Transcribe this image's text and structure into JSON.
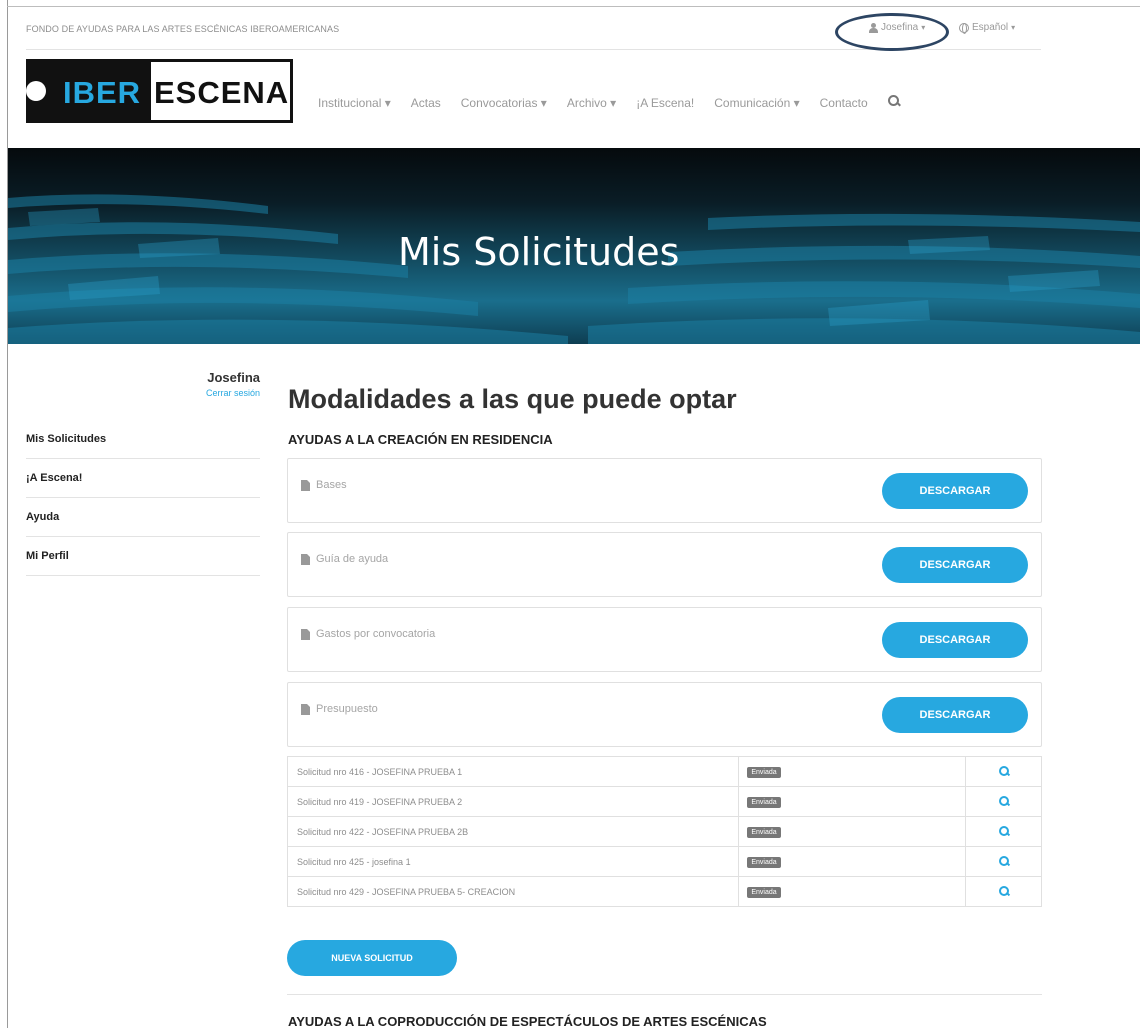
{
  "header": {
    "tagline": "FONDO DE AYUDAS PARA LAS ARTES ESCÉNICAS IBEROAMERICANAS",
    "user_menu": "Josefina",
    "language_menu": "Español",
    "caret": "▾"
  },
  "logo": {
    "part1": "IBER",
    "part2": "ESCENA"
  },
  "nav": {
    "items": [
      {
        "label": "Institucional",
        "caret": " ▾"
      },
      {
        "label": "Actas",
        "caret": ""
      },
      {
        "label": "Convocatorias",
        "caret": " ▾"
      },
      {
        "label": "Archivo",
        "caret": " ▾"
      },
      {
        "label": "¡A Escena!",
        "caret": ""
      },
      {
        "label": "Comunicación",
        "caret": " ▾"
      },
      {
        "label": "Contacto",
        "caret": ""
      }
    ]
  },
  "hero": {
    "title": "Mis Solicitudes"
  },
  "sidebar": {
    "user_name": "Josefina",
    "logout": "Cerrar sesión",
    "items": [
      {
        "label": "Mis Solicitudes"
      },
      {
        "label": "¡A Escena!"
      },
      {
        "label": "Ayuda"
      },
      {
        "label": "Mi Perfil"
      }
    ]
  },
  "main": {
    "title": "Modalidades a las que puede optar",
    "section1": {
      "title": "AYUDAS A LA CREACIÓN EN RESIDENCIA",
      "documents": [
        {
          "label": "Bases",
          "button": "DESCARGAR"
        },
        {
          "label": "Guía de ayuda",
          "button": "DESCARGAR"
        },
        {
          "label": "Gastos por convocatoria",
          "button": "DESCARGAR"
        },
        {
          "label": "Presupuesto",
          "button": "DESCARGAR"
        }
      ],
      "requests": [
        {
          "name": "Solicitud nro 416 - JOSEFINA PRUEBA 1",
          "status": "Enviada"
        },
        {
          "name": "Solicitud nro 419 - JOSEFINA PRUEBA 2",
          "status": "Enviada"
        },
        {
          "name": "Solicitud nro 422 - JOSEFINA PRUEBA 2B",
          "status": "Enviada"
        },
        {
          "name": "Solicitud nro 425 - josefina 1",
          "status": "Enviada"
        },
        {
          "name": "Solicitud nro 429 - JOSEFINA PRUEBA 5- CREACION",
          "status": "Enviada"
        }
      ],
      "new_button": "NUEVA SOLICITUD"
    },
    "section2": {
      "title": "AYUDAS A LA COPRODUCCIÓN DE ESPECTÁCULOS DE ARTES ESCÉNICAS"
    }
  },
  "colors": {
    "accent": "#27a8e0",
    "badge": "#777777",
    "annotation": "#2d4563"
  },
  "icons": [
    "user-icon",
    "globe-icon",
    "search-icon",
    "file-icon",
    "magnifier-icon"
  ]
}
